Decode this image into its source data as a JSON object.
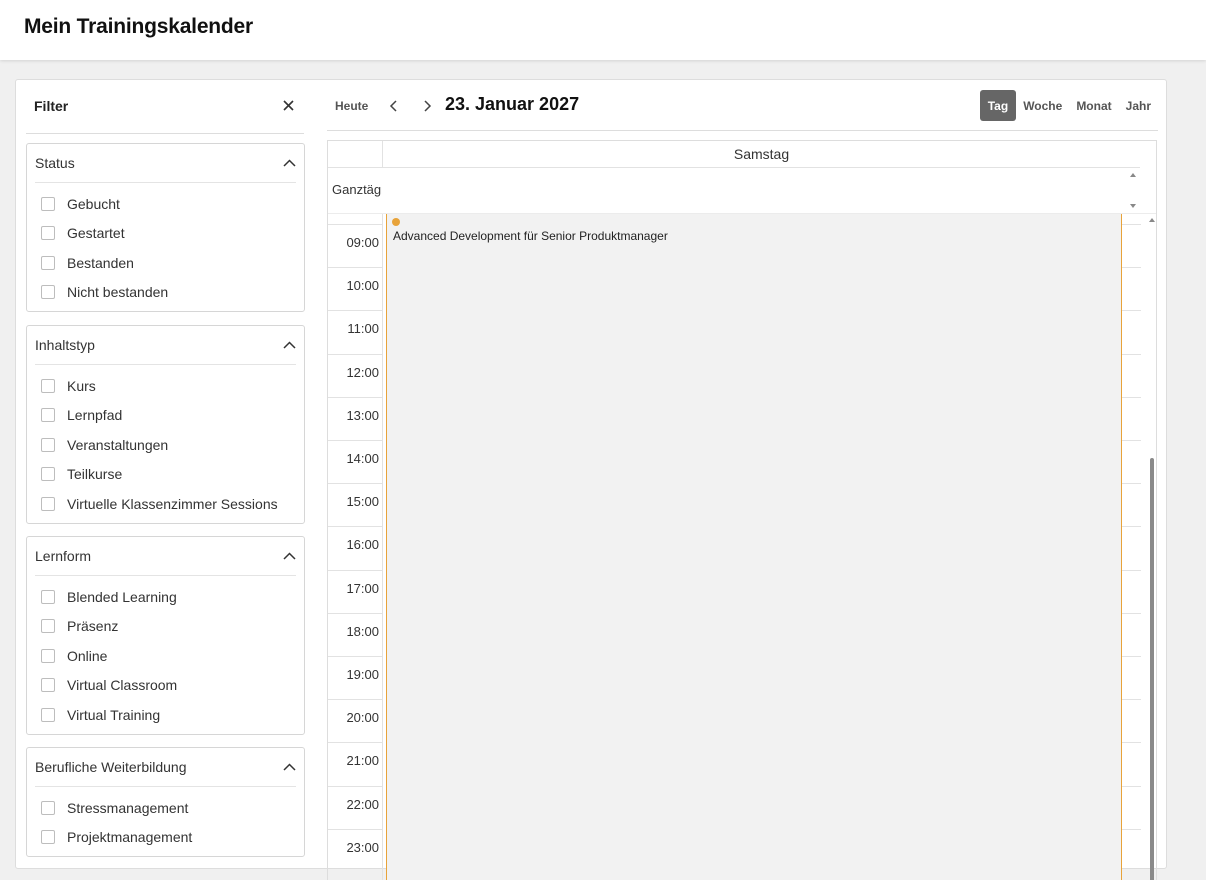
{
  "app": {
    "title": "Mein Trainingskalender"
  },
  "filter": {
    "title": "Filter",
    "groups": [
      {
        "label": "Status",
        "options": [
          "Gebucht",
          "Gestartet",
          "Bestanden",
          "Nicht bestanden"
        ]
      },
      {
        "label": "Inhaltstyp",
        "options": [
          "Kurs",
          "Lernpfad",
          "Veranstaltungen",
          "Teilkurse",
          "Virtuelle Klassenzimmer Sessions"
        ]
      },
      {
        "label": "Lernform",
        "options": [
          "Blended Learning",
          "Präsenz",
          "Online",
          "Virtual Classroom",
          "Virtual Training"
        ]
      },
      {
        "label": "Berufliche Weiterbildung",
        "options": [
          "Stressmanagement",
          "Projektmanagement"
        ]
      }
    ]
  },
  "toolbar": {
    "today": "Heute",
    "date_title": "23. Januar 2027",
    "views": [
      "Tag",
      "Woche",
      "Monat",
      "Jahr"
    ],
    "active_view": "Tag"
  },
  "calendar": {
    "day_name": "Samstag",
    "allday_label": "Ganztägig",
    "hours": [
      "09:00",
      "10:00",
      "11:00",
      "12:00",
      "13:00",
      "14:00",
      "15:00",
      "16:00",
      "17:00",
      "18:00",
      "19:00",
      "20:00",
      "21:00",
      "22:00",
      "23:00"
    ],
    "event": {
      "title": "Advanced Development für Senior Produktmanager",
      "color": "#e8a33a"
    }
  },
  "icons": {
    "close": "close-icon",
    "collapse": "chevron-up-icon",
    "prev": "chevron-left-icon",
    "next": "chevron-right-icon"
  }
}
